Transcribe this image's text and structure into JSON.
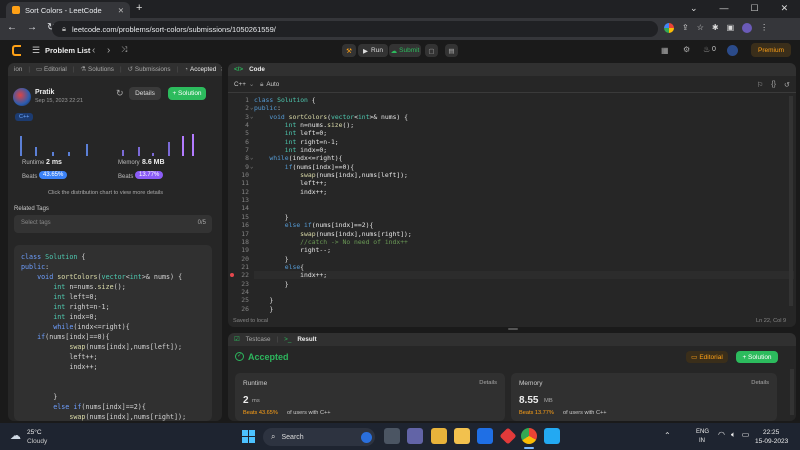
{
  "browser": {
    "tab_title": "Sort Colors - LeetCode",
    "url": "leetcode.com/problems/sort-colors/submissions/1050261559/",
    "url_scheme_icon": "lock-icon"
  },
  "nav": {
    "problem_list": "Problem List",
    "run": "Run",
    "submit": "Submit",
    "streak": "0",
    "premium": "Premium"
  },
  "left_tabs": [
    {
      "label": "ion"
    },
    {
      "label": "Editorial"
    },
    {
      "label": "Solutions"
    },
    {
      "label": "Submissions"
    },
    {
      "label": "Accepted"
    }
  ],
  "submission": {
    "user": "Pratik",
    "date": "Sep 15, 2023 22:21",
    "details": "Details",
    "solution": "+ Solution",
    "lang": "C++",
    "runtime_label": "Runtime",
    "runtime_value": "2 ms",
    "runtime_beats_label": "Beats",
    "runtime_beats": "43.65%",
    "memory_label": "Memory",
    "memory_value": "8.6 MB",
    "memory_beats_label": "Beats",
    "memory_beats": "13.77%",
    "hint": "Click the distribution chart to view more details",
    "related_tags": "Related Tags",
    "select_tags": "Select tags",
    "tag_count": "0/5"
  },
  "left_code": [
    "class Solution {",
    "public:",
    "    void sortColors(vector<int>& nums) {",
    "        int n=nums.size();",
    "        int left=0;",
    "        int right=n-1;",
    "        int indx=0;",
    "        while(indx<=right){",
    "    if(nums[indx]==0){",
    "            swap(nums[indx],nums[left]);",
    "            left++;",
    "            indx++;",
    "",
    "",
    "        }",
    "        else if(nums[indx]==2){",
    "            swap(nums[indx],nums[right]);",
    "            //catch -> No need of indx++",
    "            right--;"
  ],
  "editor": {
    "title": "Code",
    "lang": "C++",
    "mode": "Auto",
    "saved": "Saved to local",
    "cursor": "Ln 22, Col 9",
    "lines": [
      "class Solution {",
      "public:",
      "    void sortColors(vector<int>& nums) {",
      "        int n=nums.size();",
      "        int left=0;",
      "        int right=n-1;",
      "        int indx=0;",
      "    while(indx<=right){",
      "        if(nums[indx]==0){",
      "            swap(nums[indx],nums[left]);",
      "            left++;",
      "            indx++;",
      "",
      "",
      "        }",
      "        else if(nums[indx]==2){",
      "            swap(nums[indx],nums[right]);",
      "            //catch -> No need of indx++",
      "            right--;",
      "        }",
      "        else{",
      "            indx++;",
      "        }",
      "",
      "    }",
      "    }"
    ],
    "line_numbers": [
      "1",
      "2",
      "3",
      "4",
      "5",
      "6",
      "7",
      "8",
      "9",
      "10",
      "11",
      "12",
      "13",
      "14",
      "15",
      "16",
      "17",
      "18",
      "19",
      "20",
      "21",
      "22",
      "23",
      "24",
      "25",
      "26"
    ]
  },
  "result": {
    "tab_testcase": "Testcase",
    "tab_result": "Result",
    "status": "Accepted",
    "editorial": "Editorial",
    "solution": "+ Solution",
    "runtime_label": "Runtime",
    "runtime_details": "Details",
    "runtime_num": "2",
    "runtime_unit": "ms",
    "runtime_beats": "Beats 43.65%",
    "runtime_suffix": "of users with C++",
    "memory_label": "Memory",
    "memory_details": "Details",
    "memory_num": "8.55",
    "memory_unit": "MB",
    "memory_beats": "Beats 13.77%",
    "memory_suffix": "of users with C++"
  },
  "taskbar": {
    "temp": "25°C",
    "weather": "Cloudy",
    "search": "Search",
    "lang1": "ENG",
    "lang2": "IN",
    "time": "22:25",
    "date": "15-09-2023"
  },
  "colors": {
    "accent_green": "#2cbb5d",
    "accept_green": "#2db55d",
    "beats_blue": "#3b82f6",
    "beats_purple": "#8b5cf6",
    "premium": "#ffa116"
  }
}
